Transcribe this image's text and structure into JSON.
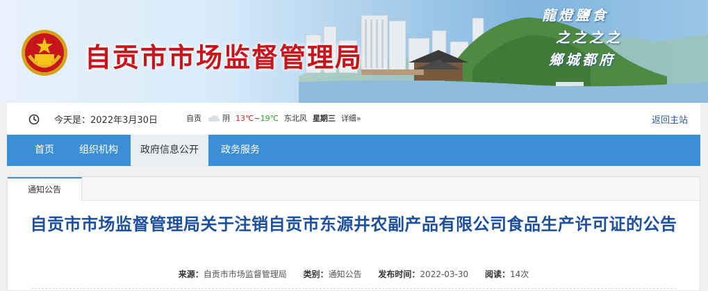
{
  "header": {
    "site_title": "自贡市市场监督管理局",
    "calligraphy_line1": "龍燈鹽食",
    "calligraphy_line2": "之之之之",
    "calligraphy_line3": "鄉城都府"
  },
  "infobar": {
    "date_text": "今天是：2022年3月30日",
    "weather": {
      "city": "自贡",
      "condition": "阴",
      "temp_high": "13℃",
      "tilde": "~",
      "temp_low": "19℃",
      "wind": "东北风",
      "weekday": "星期三",
      "detail_link": "详细»"
    },
    "back_home": "返回主站"
  },
  "nav": {
    "items": [
      {
        "label": "首页"
      },
      {
        "label": "组织机构"
      },
      {
        "label": "政府信息公开"
      },
      {
        "label": "政务服务"
      }
    ]
  },
  "content": {
    "tab_label": "通知公告",
    "title": "自贡市市场监督管理局关于注销自贡市东源井农副产品有限公司食品生产许可证的公告",
    "meta": {
      "source_key": "来源：",
      "source_val": "自贡市市场监督管理局",
      "category_key": "类别：",
      "category_val": "通知公告",
      "date_key": "发布时间：",
      "date_val": "2022-03-30",
      "views_key": "阅读：",
      "views_val": "14次"
    }
  },
  "colors": {
    "title_red": "#c8141b",
    "nav_blue": "#3b8fd6",
    "article_title_blue": "#1d4f9c"
  }
}
